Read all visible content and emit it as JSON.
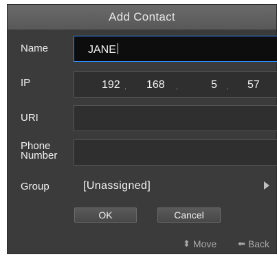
{
  "dialog": {
    "title": "Add Contact"
  },
  "fields": {
    "name": {
      "label": "Name",
      "value": "JANE"
    },
    "ip": {
      "label": "IP",
      "octets": [
        "192",
        "168",
        "5",
        "57"
      ],
      "separator": "."
    },
    "uri": {
      "label": "URI",
      "value": ""
    },
    "phone": {
      "label_line1": "Phone",
      "label_line2": "Number",
      "value": ""
    },
    "group": {
      "label": "Group",
      "value": "[Unassigned]"
    }
  },
  "buttons": {
    "ok": "OK",
    "cancel": "Cancel"
  },
  "hints": {
    "move": {
      "icon": "updown-arrow-icon",
      "glyph": "⬍",
      "label": "Move"
    },
    "back": {
      "icon": "left-arrow-icon",
      "glyph": "⬅",
      "label": "Back"
    }
  },
  "colors": {
    "focus_border": "#2f8dff",
    "background": "#3b3b3b",
    "titlebar": "#5f5f5f"
  }
}
